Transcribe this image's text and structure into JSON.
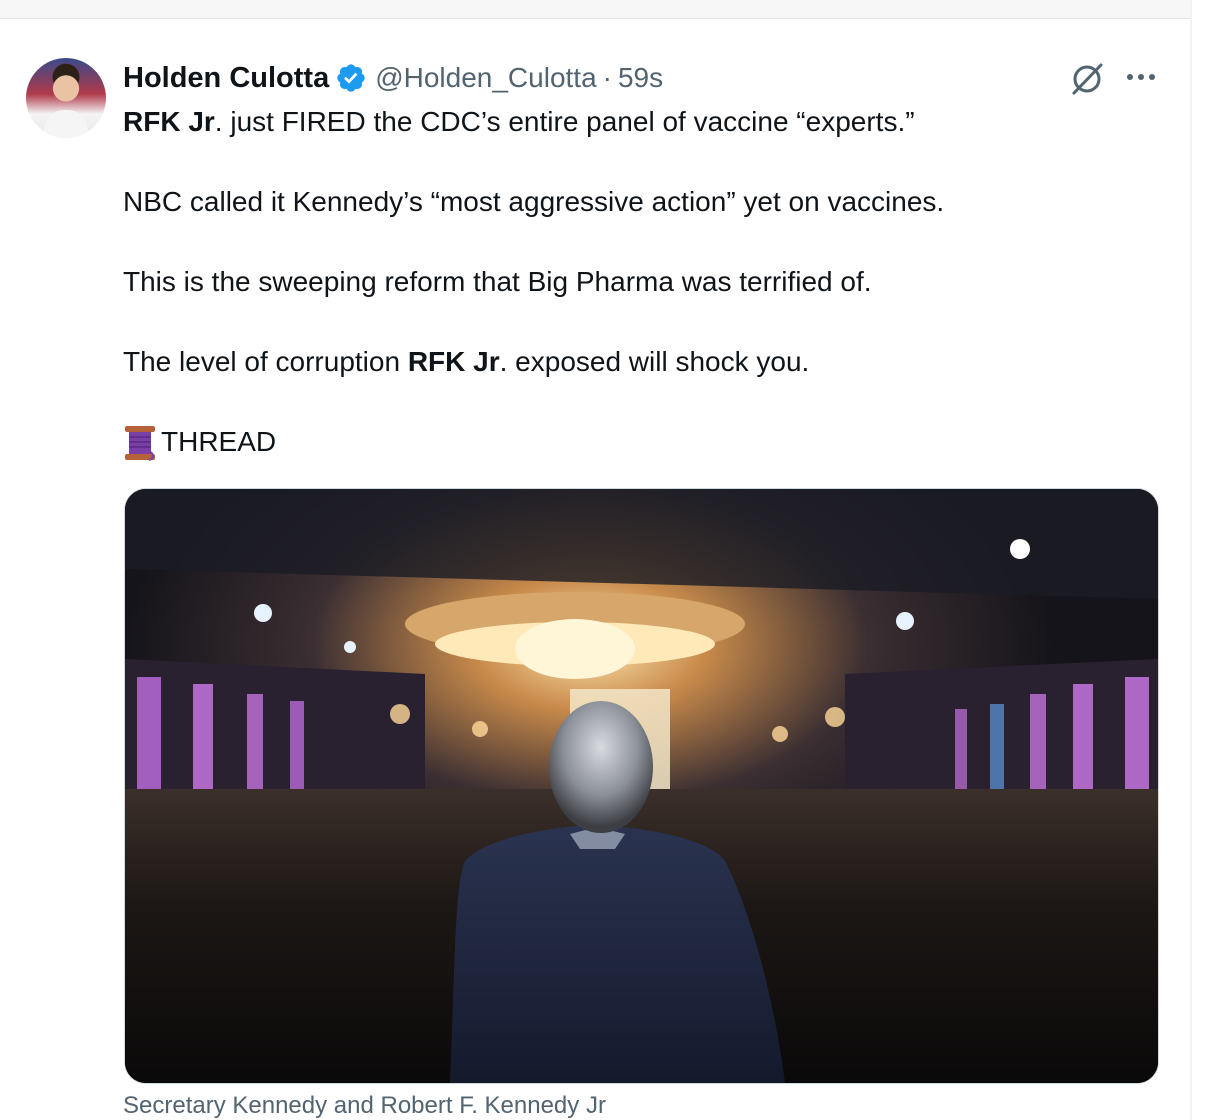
{
  "tweet": {
    "author_name": "Holden Culotta",
    "handle": "@Holden_Culotta",
    "separator": "·",
    "time": "59s",
    "verified_color": "#1d9bf0",
    "paragraphs": [
      {
        "bold": "RFK Jr",
        "rest": ". just FIRED the CDC’s entire panel of vaccine “experts.”"
      },
      {
        "text": "NBC called it Kennedy’s “most aggressive action” yet on vaccines."
      },
      {
        "text": "This is the sweeping reform that Big Pharma was terrified of."
      },
      {
        "pre": "The level of corruption ",
        "bold": "RFK Jr",
        "post": ". exposed will shock you."
      }
    ],
    "thread_label": "THREAD",
    "thread_emoji": "spool-of-thread-icon",
    "media_caption": "Secretary Kennedy and Robert F. Kennedy Jr"
  },
  "icons": {
    "grok": "grok-icon",
    "more": "more-options-icon"
  }
}
